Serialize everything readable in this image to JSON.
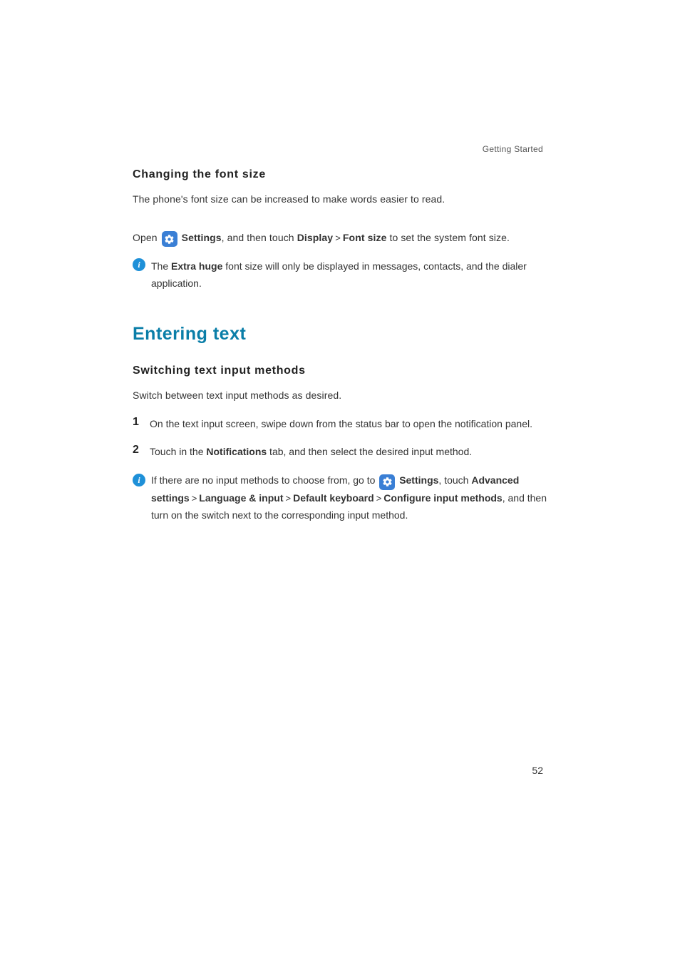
{
  "breadcrumb": "Getting Started",
  "pageNumber": "52",
  "sep": ">",
  "s1": {
    "heading": "Changing the font size",
    "intro": "The phone's font size can be increased to make words easier to read.",
    "p2": {
      "pre": "Open ",
      "settings": "Settings",
      "mid1": ", and then touch ",
      "display": "Display",
      "fontsize": "Font size",
      "post": " to set the system font size."
    },
    "note": {
      "pre": "The ",
      "bold": "Extra huge",
      "post": " font size will only be displayed in messages, contacts, and the dialer application."
    }
  },
  "s2": {
    "title": "Entering text",
    "heading": "Switching text input methods",
    "intro": "Switch between text input methods as desired.",
    "step1": "On the text input screen, swipe down from the status bar to open the notification panel.",
    "step2": {
      "pre": "Touch ",
      "mid": " in the ",
      "notifications": "Notifications",
      "post": " tab, and then select the desired input method."
    },
    "note": {
      "pre": "If there are no input methods to choose from, go to ",
      "settings": "Settings",
      "mid1": ", touch ",
      "adv": "Advanced settings",
      "lang": "Language & input",
      "defkb": "Default keyboard",
      "conf": "Configure input methods",
      "post": ", and then turn on the switch next to the corresponding input method."
    }
  },
  "nums": {
    "n1": "1",
    "n2": "2"
  },
  "infoGlyph": "i"
}
